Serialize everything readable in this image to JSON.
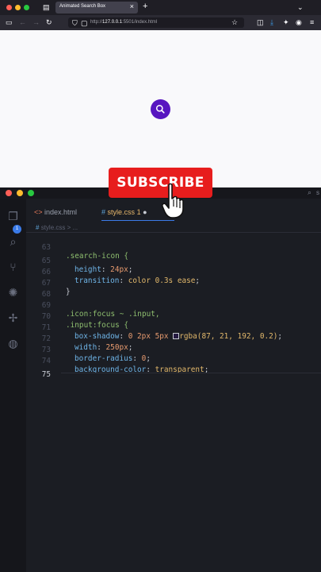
{
  "browser": {
    "tab_title": "Animated Search Box",
    "tab_close": "×",
    "new_tab": "+",
    "url_host": "127.0.0.1",
    "url_prefix": "http://",
    "url_rest": ":5501/index.html",
    "accent": "#5715c0"
  },
  "editor": {
    "tabs": [
      {
        "icon": "<>",
        "label": "index.html"
      },
      {
        "icon": "#",
        "label": "style.css",
        "badge": "1"
      }
    ],
    "breadcrumb_icon": "#",
    "breadcrumb": "style.css > ...",
    "activity_badge": "1",
    "title_right": "s",
    "lines": [
      {
        "num": "63",
        "text": ".search-icon {"
      },
      {
        "num": "65",
        "prop": "height",
        "value": "24px"
      },
      {
        "num": "66",
        "prop": "transition",
        "value": "color 0.3s ease"
      },
      {
        "num": "67",
        "text": "}"
      },
      {
        "num": "68",
        "text": ""
      },
      {
        "num": "69",
        "text": ".icon:focus ~ .input,"
      },
      {
        "num": "70",
        "text": ".input:focus {"
      },
      {
        "num": "71",
        "prop": "box-shadow",
        "value": "0 2px 5px",
        "color": "rgba(87, 21, 192, 0.2)"
      },
      {
        "num": "72",
        "prop": "width",
        "value": "250px"
      },
      {
        "num": "73",
        "prop": "border-radius",
        "value": "0"
      },
      {
        "num": "74",
        "prop": "background-color",
        "value": "transparent"
      },
      {
        "num": "75",
        "text": ""
      }
    ]
  },
  "overlay": {
    "subscribe_label": "SUBSCRIBE",
    "subscribe_color": "#e71d1d"
  }
}
